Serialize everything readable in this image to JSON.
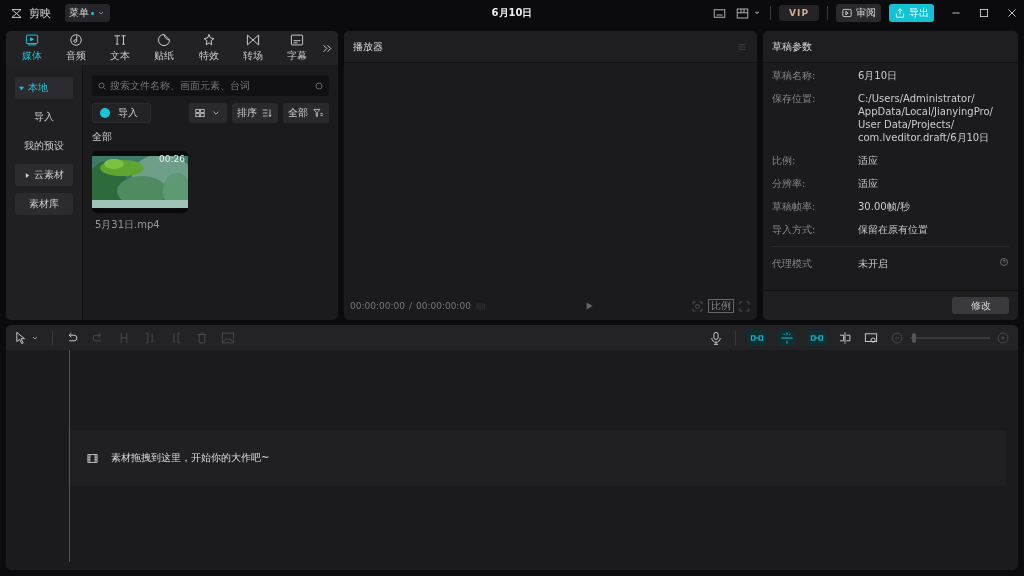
{
  "app": {
    "name": "剪映",
    "menu": "菜单",
    "menu_dot": true
  },
  "title": "6月10日",
  "header": {
    "vip": "VIP",
    "review": "审阅",
    "export": "导出"
  },
  "media_tabs": [
    {
      "label": "媒体",
      "selected": true
    },
    {
      "label": "音频",
      "selected": false
    },
    {
      "label": "文本",
      "selected": false
    },
    {
      "label": "贴纸",
      "selected": false
    },
    {
      "label": "特效",
      "selected": false
    },
    {
      "label": "转场",
      "selected": false
    },
    {
      "label": "字幕",
      "selected": false
    }
  ],
  "sidebar": {
    "items": [
      {
        "label": "本地",
        "selected": true,
        "expanded": true,
        "children": [
          {
            "label": "导入",
            "selected": false
          },
          {
            "label": "我的预设",
            "selected": false
          }
        ]
      },
      {
        "label": "云素材",
        "selected": false,
        "expanded": false
      },
      {
        "label": "素材库",
        "selected": false
      }
    ]
  },
  "search": {
    "placeholder": "搜索文件名称、画面元素、台词"
  },
  "toolbar": {
    "import": "导入",
    "sort": "排序",
    "filter": "全部"
  },
  "section": "全部",
  "media": [
    {
      "kind": "picture",
      "name": "5月31日.mp4",
      "duration": "00:26"
    }
  ],
  "player": {
    "title": "播放器",
    "current": "00:00:00:00",
    "separator": "/",
    "total": "00:00:00:00",
    "ratio": "比例"
  },
  "params": {
    "title": "草稿参数",
    "rows": [
      {
        "label": "草稿名称:",
        "value": "6月10日"
      },
      {
        "label": "保存位置:",
        "value": "C:/Users/Administrator/\nAppData/Local/JianyingPro/\nUser Data/Projects/\ncom.lveditor.draft/6月10日"
      },
      {
        "label": "比例:",
        "value": "适应"
      },
      {
        "label": "分辨率:",
        "value": "适应"
      },
      {
        "label": "草稿帧率:",
        "value": "30.00帧/秒"
      },
      {
        "label": "导入方式:",
        "value": "保留在原有位置"
      }
    ],
    "extra": {
      "label": "代理模式",
      "value": "未开启"
    },
    "button": "修改"
  },
  "timeline": {
    "tools": [
      {
        "disabled": false
      },
      {
        "disabled": false
      },
      {
        "disabled": true
      },
      {
        "disabled": true
      },
      {
        "disabled": true
      },
      {
        "disabled": true
      },
      {
        "disabled": true
      },
      {
        "disabled": true
      }
    ],
    "right_tools": [
      {
        "on": false
      },
      {
        "on": true
      },
      {
        "on": true
      },
      {
        "on": true
      },
      {
        "on": false
      },
      {
        "on": false
      }
    ],
    "zoom": {
      "level": 0.02
    },
    "hint": "素材拖拽到这里，开始你的大作吧~"
  }
}
